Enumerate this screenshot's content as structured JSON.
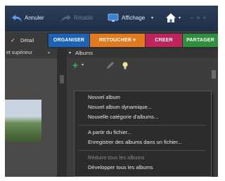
{
  "toolbar": {
    "undo_label": "Annuler",
    "redo_label": "Rétablir",
    "display_label": "Affichage",
    "display_caret": "▾",
    "home_caret": "▾",
    "window_controls": "– ≡ ×"
  },
  "view": {
    "detail_check": "✓",
    "detail_label": "Détail"
  },
  "tabs": [
    {
      "label": "ORGANISER",
      "color": "#1c63b7"
    },
    {
      "label": "RETOUCHER ▾",
      "color": "#e27a1d"
    },
    {
      "label": "CREER",
      "color": "#c0245c"
    },
    {
      "label": "PARTAGER",
      "color": "#2f8f3e"
    }
  ],
  "left_panel": {
    "location_label": "et supérieur",
    "location_caret": "▾"
  },
  "albums": {
    "header_triangle": "▾",
    "header_label": "Albums",
    "add_symbol": "+",
    "add_caret": "▾"
  },
  "menu": {
    "items": [
      {
        "label": "Nouvel album",
        "enabled": true
      },
      {
        "label": "Nouvel album dynamique...",
        "enabled": true
      },
      {
        "label": "Nouvelle catégorie d'albums...",
        "enabled": true
      },
      {
        "label": "A partir du fichier...",
        "enabled": true
      },
      {
        "label": "Enregistrer des albums dans un fichier...",
        "enabled": true
      },
      {
        "label": "Réduire tous les albums",
        "enabled": false
      },
      {
        "label": "Développer tous les albums",
        "enabled": true
      }
    ]
  }
}
